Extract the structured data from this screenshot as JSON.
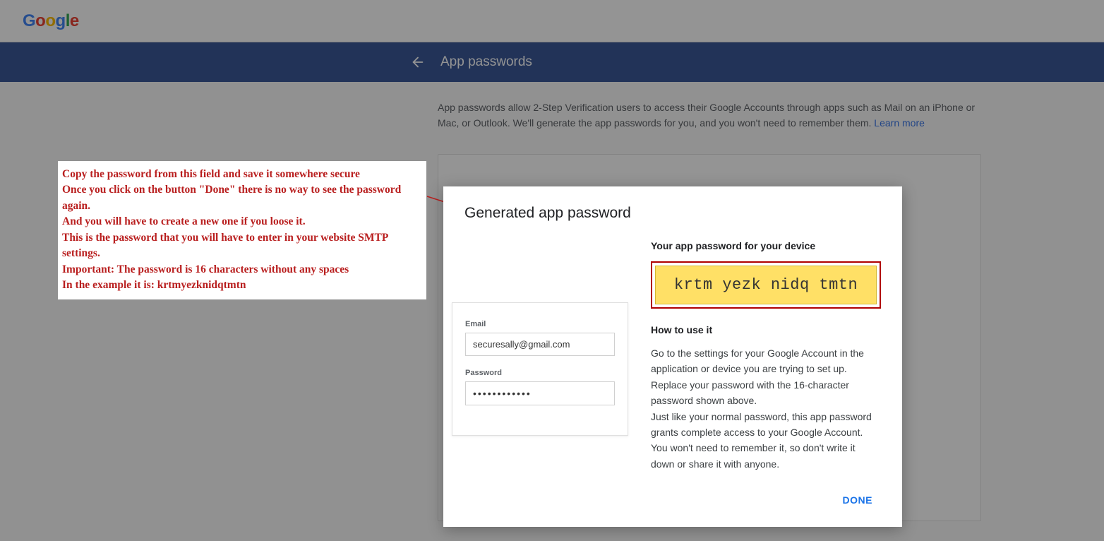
{
  "top": {
    "logo": {
      "g": "G",
      "o1": "o",
      "o2": "o",
      "g2": "g",
      "l": "l",
      "e": "e"
    }
  },
  "bluebar": {
    "title": "App passwords"
  },
  "description": {
    "text": "App passwords allow 2-Step Verification users to access their Google Accounts through apps such as Mail on an iPhone or Mac, or Outlook. We'll generate the app passwords for you, and you won't need to remember them. ",
    "learn_more": "Learn more"
  },
  "annotation": {
    "line1": "Copy the password from this field and save it somewhere secure",
    "line2": "Once you click on the button \"Done\" there is no way to see the password again.",
    "line3": "And you will have to create a new one if you loose it.",
    "line4": "This is the password that you will have to enter in your website SMTP settings.",
    "line5": "Important: The password is 16 characters without any spaces",
    "line6": "In the example it is: krtmyezknidqtmtn"
  },
  "modal": {
    "title": "Generated app password",
    "device_heading": "Your app password for your device",
    "password": "krtm yezk nidq tmtn",
    "howto_title": "How to use it",
    "howto_p1": "Go to the settings for your Google Account in the application or device you are trying to set up. Replace your password with the 16-character password shown above.",
    "howto_p2": "Just like your normal password, this app password grants complete access to your Google Account. You won't need to remember it, so don't write it down or share it with anyone.",
    "email_label": "Email",
    "email_value": "securesally@gmail.com",
    "password_label": "Password",
    "password_masked": "••••••••••••",
    "done": "DONE"
  }
}
